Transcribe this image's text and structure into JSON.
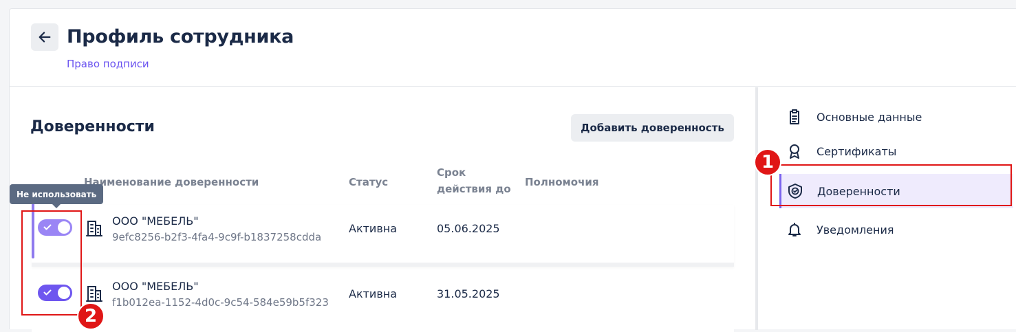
{
  "header": {
    "title": "Профиль сотрудника",
    "breadcrumb": "Право подписи"
  },
  "section": {
    "title": "Доверенности",
    "add_button": "Добавить доверенность"
  },
  "table": {
    "columns": [
      "Наименование доверенности",
      "Статус",
      "Срок действия до",
      "Полномочия"
    ],
    "rows": [
      {
        "enabled": true,
        "name": "ООО \"МЕБЕЛЬ\"",
        "id": "9efc8256-b2f3-4fa4-9c9f-b1837258cdda",
        "status": "Активна",
        "valid_until": "05.06.2025",
        "permissions": ""
      },
      {
        "enabled": true,
        "name": "ООО \"МЕБЕЛЬ\"",
        "id": "f1b012ea-1152-4d0c-9c54-584e59b5f323",
        "status": "Активна",
        "valid_until": "31.05.2025",
        "permissions": ""
      }
    ]
  },
  "tooltip": "Не использовать",
  "sidebar": {
    "items": [
      {
        "label": "Основные данные",
        "icon": "clipboard-icon",
        "active": false
      },
      {
        "label": "Сертификаты",
        "icon": "award-icon",
        "active": false
      },
      {
        "label": "Доверенности",
        "icon": "shield-check-icon",
        "active": true
      },
      {
        "label": "Уведомления",
        "icon": "bell-icon",
        "active": false
      }
    ]
  },
  "annotations": {
    "badge_1": "1",
    "badge_2": "2"
  },
  "colors": {
    "accent": "#6e56ef",
    "active_bg": "#efebfd",
    "highlight": "#e01616",
    "text": "#1b2a47"
  }
}
